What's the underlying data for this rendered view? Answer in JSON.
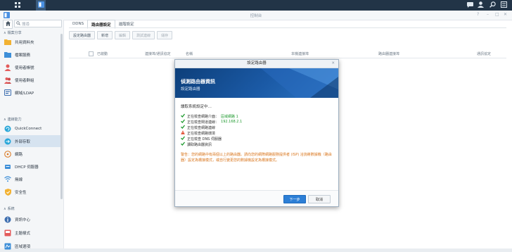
{
  "window": {
    "title": "控制台"
  },
  "sidebar": {
    "search_placeholder": "搜尋",
    "sections": [
      {
        "label": "檔案分享"
      },
      {
        "label": "連線能力"
      },
      {
        "label": "系統"
      }
    ],
    "items": [
      {
        "label": "共用資料夾",
        "icon": "shared-folder-icon"
      },
      {
        "label": "檔案服務",
        "icon": "file-services-icon"
      },
      {
        "label": "使用者帳號",
        "icon": "user-icon"
      },
      {
        "label": "使用者群組",
        "icon": "group-icon"
      },
      {
        "label": "網域/LDAP",
        "icon": "domain-ldap-icon"
      },
      {
        "label": "QuickConnect",
        "icon": "quickconnect-icon"
      },
      {
        "label": "外部存取",
        "icon": "external-access-icon"
      },
      {
        "label": "網路",
        "icon": "network-icon"
      },
      {
        "label": "DHCP 伺服器",
        "icon": "dhcp-server-icon"
      },
      {
        "label": "無線",
        "icon": "wireless-icon"
      },
      {
        "label": "安全性",
        "icon": "security-icon"
      },
      {
        "label": "資訊中心",
        "icon": "info-center-icon"
      },
      {
        "label": "主題樣式",
        "icon": "theme-icon"
      },
      {
        "label": "區域選項",
        "icon": "regional-options-icon"
      }
    ]
  },
  "tabs": [
    "DDNS",
    "路由器設定",
    "進階設定"
  ],
  "toolbar": [
    "設定路由器",
    "新增",
    "編輯",
    "測試連線",
    "儲存"
  ],
  "table_headers": [
    "已啟動",
    "連接埠/通訊協定",
    "名稱",
    "本機連接埠",
    "路由器連接埠",
    "通訊協定"
  ],
  "modal": {
    "title": "設定路由器",
    "banner_title": "偵測路由器資訊",
    "banner_subtitle": "設定路由器",
    "lead": "讀取系統設定中…",
    "steps": [
      {
        "text": "正在檢查網路介面：",
        "value": "區域網路 1",
        "status": "ok"
      },
      {
        "text": "正在檢查閘道連線：",
        "value": "192.168.2.1",
        "status": "ok"
      },
      {
        "text": "正在檢查網路連線",
        "value": "",
        "status": "ok"
      },
      {
        "text": "正在檢查網路環境",
        "value": "",
        "status": "warn"
      },
      {
        "text": "正在檢查 DNS 伺服器",
        "value": "",
        "status": "ok"
      },
      {
        "text": "讀取路由器資訊",
        "value": "",
        "status": "ok"
      }
    ],
    "warning": "警告：您的網路中有兩個以上的路由器。請向您的網際網路服務提供者 (ISP) 洽詢將數據機（路由器）設定為橋接模式，或自行變更您的數據機設定為橋接模式。",
    "next_label": "下一步",
    "cancel_label": "取消"
  },
  "colors": {
    "accent": "#2d7fd6",
    "warning": "#d9751c",
    "ok": "#1f9a2f"
  }
}
